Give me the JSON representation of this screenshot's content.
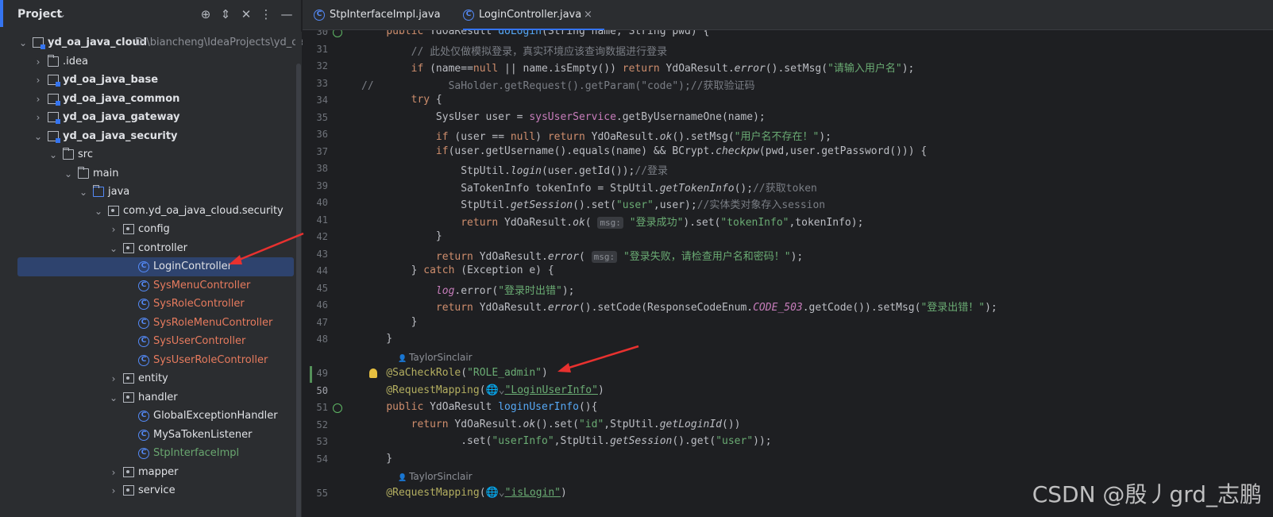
{
  "project_panel": {
    "title": "Project",
    "icons": [
      "crosshair-icon",
      "expand-collapse-icon",
      "collapse-all-icon",
      "more-options-icon",
      "minimize-icon"
    ],
    "tree": [
      {
        "label": "yd_oa_java_cloud",
        "path": "D:\\biancheng\\IdeaProjects\\yd_oa_j",
        "kind": "module",
        "level": 0,
        "expanded": true,
        "bold": true
      },
      {
        "label": ".idea",
        "kind": "folder",
        "level": 1,
        "expanded": false
      },
      {
        "label": "yd_oa_java_base",
        "kind": "module",
        "level": 1,
        "expanded": false,
        "bold": true
      },
      {
        "label": "yd_oa_java_common",
        "kind": "module",
        "level": 1,
        "expanded": false,
        "bold": true
      },
      {
        "label": "yd_oa_java_gateway",
        "kind": "module",
        "level": 1,
        "expanded": false,
        "bold": true
      },
      {
        "label": "yd_oa_java_security",
        "kind": "module",
        "level": 1,
        "expanded": true,
        "bold": true
      },
      {
        "label": "src",
        "kind": "folder",
        "level": 2,
        "expanded": true
      },
      {
        "label": "main",
        "kind": "folder",
        "level": 3,
        "expanded": true
      },
      {
        "label": "java",
        "kind": "folder-src",
        "level": 4,
        "expanded": true
      },
      {
        "label": "com.yd_oa_java_cloud.security",
        "kind": "package",
        "level": 5,
        "expanded": true
      },
      {
        "label": "config",
        "kind": "package",
        "level": 6,
        "expanded": false
      },
      {
        "label": "controller",
        "kind": "package",
        "level": 6,
        "expanded": true
      },
      {
        "label": "LoginController",
        "kind": "class",
        "level": 7,
        "selected": true
      },
      {
        "label": "SysMenuController",
        "kind": "class",
        "level": 7,
        "status": "orange"
      },
      {
        "label": "SysRoleController",
        "kind": "class",
        "level": 7,
        "status": "orange"
      },
      {
        "label": "SysRoleMenuController",
        "kind": "class",
        "level": 7,
        "status": "orange"
      },
      {
        "label": "SysUserController",
        "kind": "class",
        "level": 7,
        "status": "orange"
      },
      {
        "label": "SysUserRoleController",
        "kind": "class",
        "level": 7,
        "status": "orange"
      },
      {
        "label": "entity",
        "kind": "package",
        "level": 6,
        "expanded": false
      },
      {
        "label": "handler",
        "kind": "package",
        "level": 6,
        "expanded": true
      },
      {
        "label": "GlobalExceptionHandler",
        "kind": "class",
        "level": 7
      },
      {
        "label": "MySaTokenListener",
        "kind": "class",
        "level": 7
      },
      {
        "label": "StpInterfaceImpl",
        "kind": "class",
        "level": 7,
        "status": "green"
      },
      {
        "label": "mapper",
        "kind": "package",
        "level": 6,
        "expanded": false
      },
      {
        "label": "service",
        "kind": "package",
        "level": 6,
        "expanded": false
      }
    ]
  },
  "tabs": [
    {
      "label": "StpInterfaceImpl.java",
      "active": false
    },
    {
      "label": "LoginController.java",
      "active": true,
      "close": "×"
    }
  ],
  "editor": {
    "lines": [
      {
        "num": "30",
        "html": "    <span class='kw'>public</span> YdOaResult <span class='fn'>doLogin</span>(String name, String pwd) {",
        "icon": "run"
      },
      {
        "num": "31",
        "html": "        <span class='cm'>// 此处仅做模拟登录，真实环境应该查询数据进行登录</span>"
      },
      {
        "num": "32",
        "html": "        <span class='kw'>if</span> (name==<span class='kw'>null</span> || name.isEmpty()) <span class='kw'>return</span> YdOaResult.<span class='it'>error</span>().setMsg(<span class='str'>\"请输入用户名\"</span>);"
      },
      {
        "num": "33",
        "html": "<span class='cm'>//            SaHolder.getRequest().getParam(\"code\");//获取验证码</span>"
      },
      {
        "num": "34",
        "html": "        <span class='kw'>try</span> {"
      },
      {
        "num": "35",
        "html": "            SysUser user = <span class='fld'>sysUserService</span>.getByUsernameOne(name);"
      },
      {
        "num": "36",
        "html": "            <span class='kw'>if</span> (user == <span class='kw'>null</span>) <span class='kw'>return</span> YdOaResult.<span class='it'>ok</span>().setMsg(<span class='str'>\"用户名不存在！\"</span>);"
      },
      {
        "num": "37",
        "html": "            <span class='kw'>if</span>(user.getUsername().equals(name) &amp;&amp; BCrypt.<span class='it'>checkpw</span>(pwd,user.getPassword())) {"
      },
      {
        "num": "38",
        "html": "                StpUtil.<span class='it'>login</span>(user.getId());<span class='cm'>//登录</span>"
      },
      {
        "num": "39",
        "html": "                SaTokenInfo tokenInfo = StpUtil.<span class='it'>getTokenInfo</span>();<span class='cm'>//获取token</span>"
      },
      {
        "num": "40",
        "html": "                StpUtil.<span class='it'>getSession</span>().set(<span class='str'>\"user\"</span>,user);<span class='cm'>//实体类对象存入session</span>"
      },
      {
        "num": "41",
        "html": "                <span class='kw'>return</span> YdOaResult.<span class='it'>ok</span>( <span class='hint-box'>msg:</span> <span class='str'>\"登录成功\"</span>).set(<span class='str'>\"tokenInfo\"</span>,tokenInfo);"
      },
      {
        "num": "42",
        "html": "            }"
      },
      {
        "num": "43",
        "html": "            <span class='kw'>return</span> YdOaResult.<span class='it'>error</span>( <span class='hint-box'>msg:</span> <span class='str'>\"登录失败，请检查用户名和密码！\"</span>);"
      },
      {
        "num": "44",
        "html": "        } <span class='kw'>catch</span> (Exception e) {"
      },
      {
        "num": "45",
        "html": "            <span class='fld it'>log</span>.error(<span class='str'>\"登录时出错\"</span>);"
      },
      {
        "num": "46",
        "html": "            <span class='kw'>return</span> YdOaResult.<span class='it'>error</span>().setCode(ResponseCodeEnum.<span class='cnst'>CODE_503</span>.getCode()).setMsg(<span class='str'>\"登录出错！\"</span>);"
      },
      {
        "num": "47",
        "html": "        }"
      },
      {
        "num": "48",
        "html": "    }"
      },
      {
        "inlay": "TaylorSinclair"
      },
      {
        "num": "49",
        "html": "    <span class='ann'>@SaCheckRole</span>(<span class='str'>\"ROLE_admin\"</span>)",
        "icon": "bulb",
        "changed": true
      },
      {
        "num": "50",
        "html": "    <span class='ann'>@RequestMapping</span>(<span class='cm'>🌐⌄</span><span class='link'>\"LoginUserInfo\"</span>)",
        "current": true
      },
      {
        "num": "51",
        "html": "    <span class='kw'>public</span> YdOaResult <span class='fn'>loginUserInfo</span>(){",
        "icon": "run"
      },
      {
        "num": "52",
        "html": "        <span class='kw'>return</span> YdOaResult.<span class='it'>ok</span>().set(<span class='str'>\"id\"</span>,StpUtil.<span class='it'>getLoginId</span>())"
      },
      {
        "num": "53",
        "html": "                .set(<span class='str'>\"userInfo\"</span>,StpUtil.<span class='it'>getSession</span>().get(<span class='str'>\"user\"</span>));"
      },
      {
        "num": "54",
        "html": "    }"
      },
      {
        "inlay": "TaylorSinclair"
      },
      {
        "num": "55",
        "html": "    <span class='ann'>@RequestMapping</span>(<span class='cm'>🌐⌄</span><span class='link'>\"isLogin\"</span>)"
      }
    ]
  },
  "watermark": "CSDN @殷丿grd_志鹏",
  "colors": {
    "accent": "#3574f0",
    "annotation_arrow": "#e8312f",
    "selection": "#2e436e"
  }
}
